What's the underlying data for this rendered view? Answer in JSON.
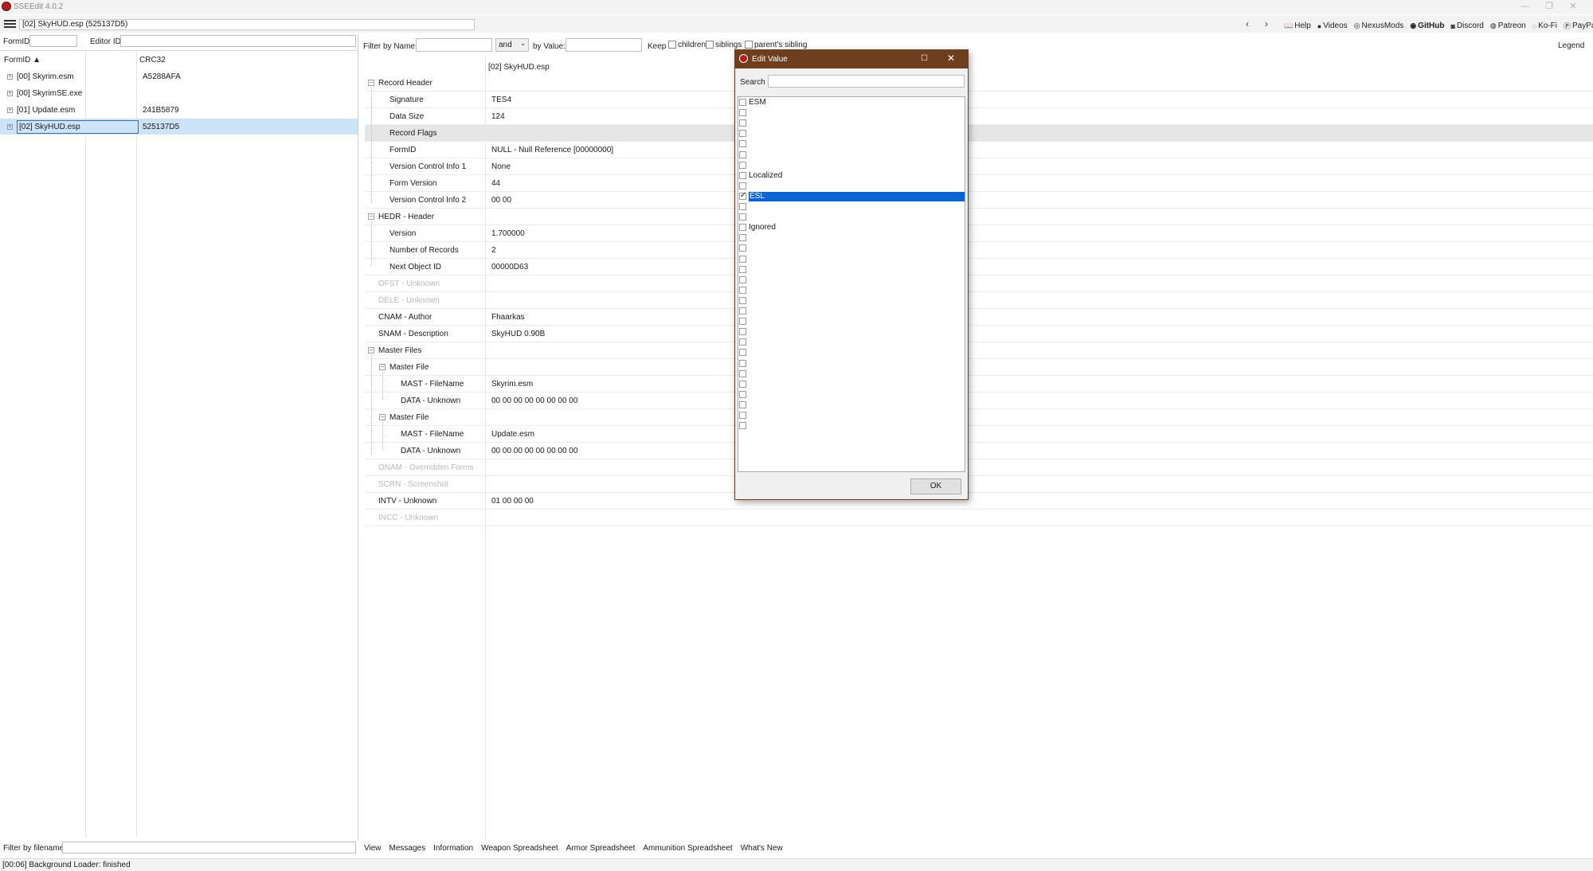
{
  "window": {
    "title": "SSEEdit 4.0.2",
    "controls": {
      "minimize": "—",
      "restore": "❐",
      "close": "✕"
    }
  },
  "toolbar": {
    "path": "[02] SkyHUD.esp (525137D5)",
    "back": "‹",
    "forward": "›",
    "links": [
      {
        "icon": "📖",
        "label": "Help"
      },
      {
        "icon": "●",
        "label": "Videos"
      },
      {
        "icon": "◎",
        "label": "NexusMods"
      },
      {
        "icon": "◉",
        "label": "GitHub"
      },
      {
        "icon": "◙",
        "label": "Discord"
      },
      {
        "icon": "◍",
        "label": "Patreon"
      },
      {
        "icon": "◌",
        "label": "Ko-Fi"
      },
      {
        "icon": "Ⓟ",
        "label": "PayPal"
      }
    ]
  },
  "left": {
    "formid_label": "FormID",
    "editorid_label": "Editor ID",
    "col_formid": "FormID ▲",
    "col_crc": "CRC32",
    "files": [
      {
        "name": "[00] Skyrim.esm",
        "crc": "A5288AFA"
      },
      {
        "name": "[00] SkyrimSE.exe",
        "crc": ""
      },
      {
        "name": "[01] Update.esm",
        "crc": "241B5879"
      },
      {
        "name": "[02] SkyHUD.esp",
        "crc": "525137D5"
      }
    ],
    "filter_label": "Filter by filename:"
  },
  "filterbar": {
    "by_name": "Filter by Name:",
    "and_value": "and",
    "by_value": "by Value:",
    "keep": "Keep",
    "children": "children",
    "siblings": "siblings",
    "parents_sibling": "parent's sibling",
    "legend": "Legend"
  },
  "grid": {
    "header_file": "[02] SkyHUD.esp",
    "rows": [
      {
        "name": "Record Header",
        "value": ""
      },
      {
        "name": "Signature",
        "value": "TES4"
      },
      {
        "name": "Data Size",
        "value": "124"
      },
      {
        "name": "Record Flags",
        "value": ""
      },
      {
        "name": "FormID",
        "value": "NULL - Null Reference [00000000]"
      },
      {
        "name": "Version Control Info 1",
        "value": "None"
      },
      {
        "name": "Form Version",
        "value": "44"
      },
      {
        "name": "Version Control Info 2",
        "value": "00 00"
      },
      {
        "name": "HEDR - Header",
        "value": ""
      },
      {
        "name": "Version",
        "value": "1.700000"
      },
      {
        "name": "Number of Records",
        "value": "2"
      },
      {
        "name": "Next Object ID",
        "value": "00000D63"
      },
      {
        "name": "OFST - Unknown",
        "value": ""
      },
      {
        "name": "DELE - Unknown",
        "value": ""
      },
      {
        "name": "CNAM - Author",
        "value": "Fhaarkas"
      },
      {
        "name": "SNAM - Description",
        "value": "SkyHUD 0.90B"
      },
      {
        "name": "Master Files",
        "value": ""
      },
      {
        "name": "Master File",
        "value": ""
      },
      {
        "name": "MAST - FileName",
        "value": "Skyrim.esm"
      },
      {
        "name": "DATA - Unknown",
        "value": "00 00 00 00 00 00 00 00"
      },
      {
        "name": "Master File",
        "value": ""
      },
      {
        "name": "MAST - FileName",
        "value": "Update.esm"
      },
      {
        "name": "DATA - Unknown",
        "value": "00 00 00 00 00 00 00 00"
      },
      {
        "name": "ONAM - Overridden Forms",
        "value": ""
      },
      {
        "name": "SCRN - Screenshot",
        "value": ""
      },
      {
        "name": "INTV - Unknown",
        "value": "01 00 00 00"
      },
      {
        "name": "INCC - Unknown",
        "value": ""
      }
    ]
  },
  "tabs": [
    "View",
    "Messages",
    "Information",
    "Weapon Spreadsheet",
    "Armor Spreadsheet",
    "Ammunition Spreadsheet",
    "What's New"
  ],
  "status": "[00:06] Background Loader: finished",
  "dialog": {
    "title": "Edit Value",
    "search_label": "Search",
    "ok": "OK",
    "flags": [
      {
        "label": "ESM",
        "checked": false
      },
      {
        "label": "",
        "checked": false
      },
      {
        "label": "",
        "checked": false
      },
      {
        "label": "",
        "checked": false
      },
      {
        "label": "",
        "checked": false
      },
      {
        "label": "",
        "checked": false
      },
      {
        "label": "",
        "checked": false
      },
      {
        "label": "Localized",
        "checked": false
      },
      {
        "label": "",
        "checked": false
      },
      {
        "label": "ESL",
        "checked": true
      },
      {
        "label": "",
        "checked": false
      },
      {
        "label": "",
        "checked": false
      },
      {
        "label": "Ignored",
        "checked": false
      }
    ],
    "empty_rows": 19
  }
}
